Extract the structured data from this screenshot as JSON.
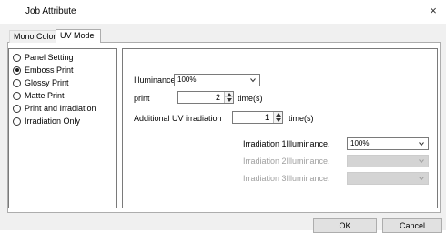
{
  "window": {
    "title": "Job Attribute",
    "close_glyph": "×"
  },
  "tabs": [
    {
      "label": "Mono Color",
      "active": false
    },
    {
      "label": "UV Mode",
      "active": true
    }
  ],
  "modes": [
    {
      "label": "Panel Setting",
      "checked": false
    },
    {
      "label": "Emboss Print",
      "checked": true
    },
    {
      "label": "Glossy Print",
      "checked": false
    },
    {
      "label": "Matte Print",
      "checked": false
    },
    {
      "label": "Print and Irradiation",
      "checked": false
    },
    {
      "label": "Irradiation Only",
      "checked": false
    }
  ],
  "settings": {
    "illuminance_label": "Illuminance",
    "illuminance_value": "100%",
    "print_label": "print",
    "print_value": "2",
    "print_unit": "time(s)",
    "additional_label": "Additional UV irradiation",
    "additional_value": "1",
    "additional_unit": "time(s)",
    "irr1_label": "Irradiation 1Illuminance.",
    "irr1_value": "100%",
    "irr2_label": "Irradiation 2Illuminance.",
    "irr2_value": "",
    "irr3_label": "Irradiation 3Illuminance.",
    "irr3_value": ""
  },
  "buttons": {
    "ok": "OK",
    "cancel": "Cancel"
  },
  "icons": {
    "close": "close-icon",
    "dropdown": "chevron-down-icon",
    "spin_up": "arrow-up-icon",
    "spin_down": "arrow-down-icon"
  }
}
